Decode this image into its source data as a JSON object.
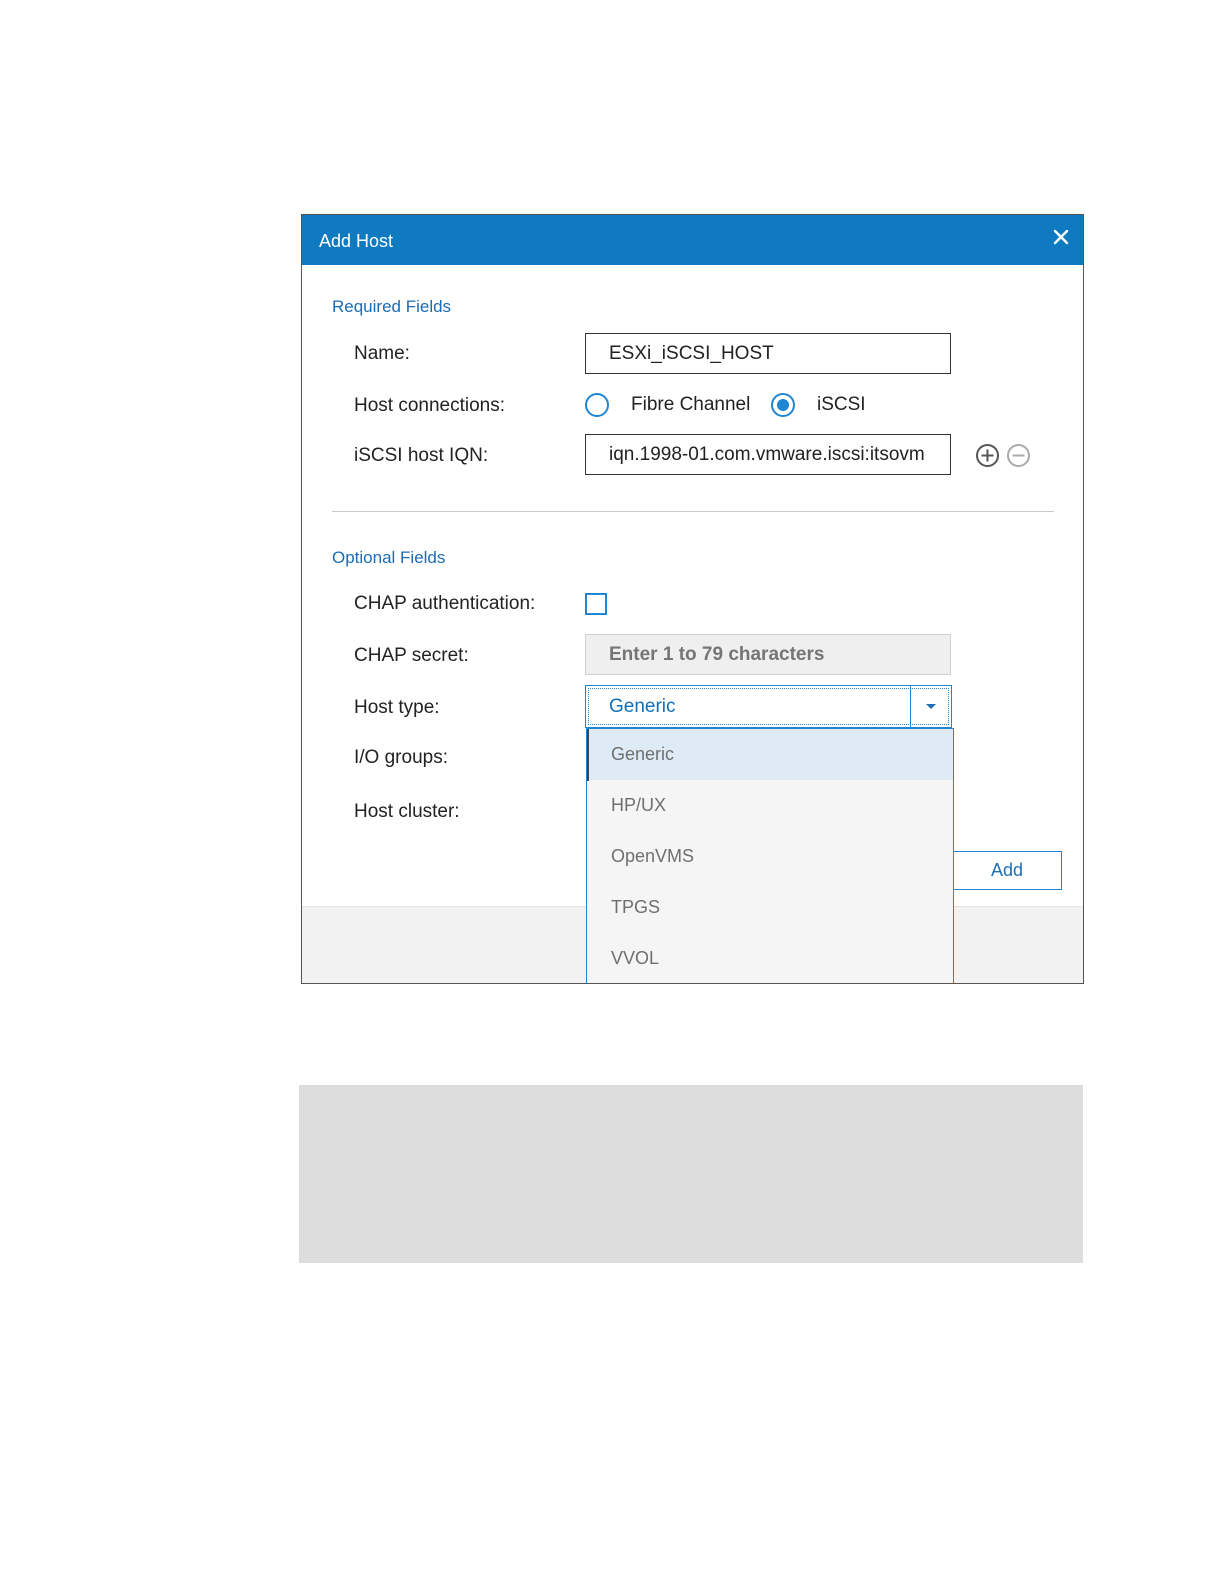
{
  "dialog": {
    "title": "Add Host",
    "required_section": "Required Fields",
    "optional_section": "Optional Fields",
    "fields": {
      "name_label": "Name:",
      "name_value": "ESXi_iSCSI_HOST",
      "host_connections_label": "Host connections:",
      "connection_options": [
        "Fibre Channel",
        "iSCSI"
      ],
      "selected_connection": "iSCSI",
      "iqn_label": "iSCSI host IQN:",
      "iqn_value": "iqn.1998-01.com.vmware.iscsi:itsovm",
      "chap_auth_label": "CHAP authentication:",
      "chap_auth_checked": false,
      "chap_secret_label": "CHAP secret:",
      "chap_secret_placeholder": "Enter 1 to 79 characters",
      "host_type_label": "Host type:",
      "host_type_value": "Generic",
      "io_groups_label": "I/O groups:",
      "host_cluster_label": "Host cluster:"
    },
    "host_type_options": [
      "Generic",
      "HP/UX",
      "OpenVMS",
      "TPGS",
      "VVOL"
    ],
    "highlighted_option": "Generic",
    "add_button": "Add",
    "icons": {
      "close": "close-icon",
      "add": "plus-circle-icon",
      "remove": "minus-circle-icon",
      "dropdown": "caret-down-icon"
    },
    "colors": {
      "titlebar": "#0f7ac0",
      "accent": "#1f86d3",
      "section": "#1c6bb3"
    }
  }
}
